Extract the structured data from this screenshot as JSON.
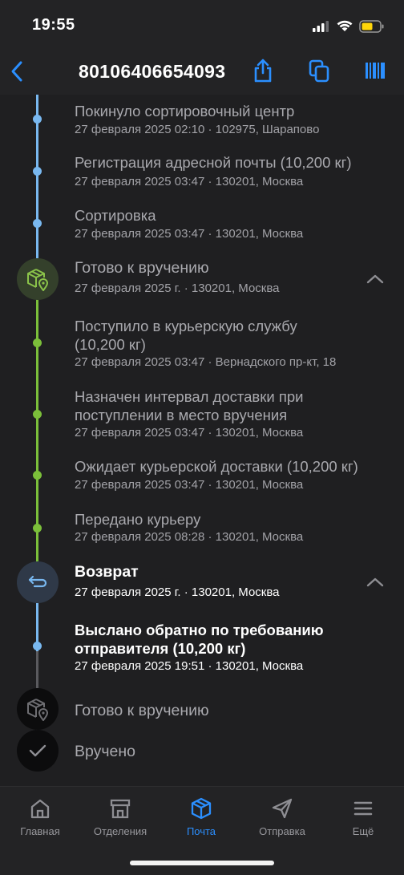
{
  "status": {
    "time": "19:55"
  },
  "header": {
    "title": "80106406654093"
  },
  "events": [
    {
      "title": "Покинуло сортировочный центр",
      "sub": "27 февраля 2025 02:10 · 102975, Шарапово"
    },
    {
      "title": "Регистрация адресной почты (10,200 кг)",
      "sub": "27 февраля 2025 03:47 · 130201, Москва"
    },
    {
      "title": "Сортировка",
      "sub": "27 февраля 2025 03:47 · 130201, Москва"
    }
  ],
  "group_ready": {
    "title": "Готово к вручению",
    "sub": "27 февраля 2025 г. · 130201, Москва",
    "events": [
      {
        "title": "Поступило в курьерскую службу (10,200 кг)",
        "sub": "27 февраля 2025 03:47 · Вернадского пр-кт, 18"
      },
      {
        "title": "Назначен интервал доставки при поступлении в место вручения",
        "sub": "27 февраля 2025 03:47 · 130201, Москва"
      },
      {
        "title": "Ожидает курьерской доставки (10,200 кг)",
        "sub": "27 февраля 2025 03:47 · 130201, Москва"
      },
      {
        "title": "Передано курьеру",
        "sub": "27 февраля 2025 08:28 · 130201, Москва"
      }
    ]
  },
  "group_return": {
    "title": "Возврат",
    "sub": "27 февраля 2025 г. · 130201, Москва",
    "events": [
      {
        "title": "Выслано обратно по требованию отправителя (10,200 кг)",
        "sub": "27 февраля 2025 19:51 · 130201, Москва"
      }
    ]
  },
  "future": [
    {
      "title": "Готово к вручению",
      "icon": "parcel-location-icon"
    },
    {
      "title": "Вручено",
      "icon": "checkmark-icon"
    }
  ],
  "tabs": [
    {
      "label": "Главная",
      "icon": "home-icon"
    },
    {
      "label": "Отделения",
      "icon": "store-icon"
    },
    {
      "label": "Почта",
      "icon": "parcel-icon"
    },
    {
      "label": "Отправка",
      "icon": "send-icon"
    },
    {
      "label": "Ещё",
      "icon": "menu-icon"
    }
  ],
  "colors": {
    "accent": "#2b8fff",
    "blue_line": "#79b8f0",
    "green_line": "#7bbf3a",
    "green_dark": "#34402b"
  }
}
